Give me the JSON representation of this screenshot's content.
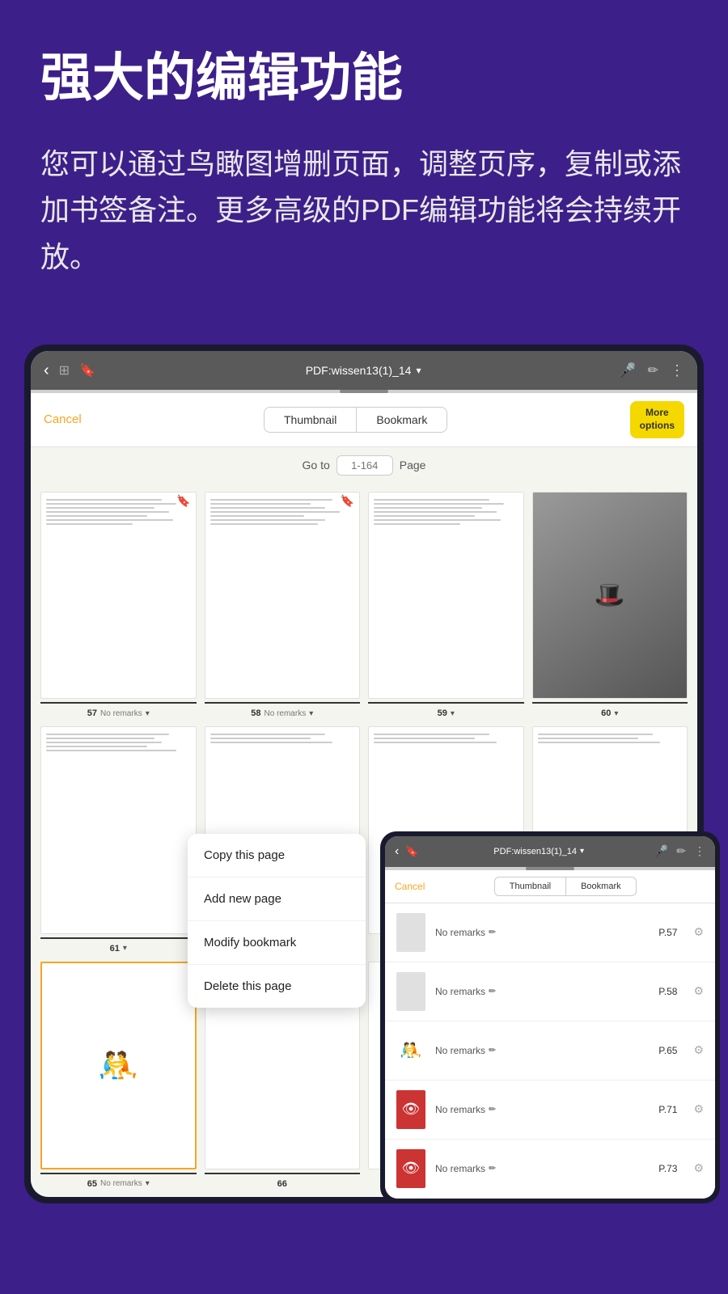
{
  "background_color": "#3d1f8a",
  "header": {
    "title": "强大的编辑功能",
    "description": "您可以通过鸟瞰图增删页面，调整页序，复制或添加书签备注。更多高级的PDF编辑功能将会持续开放。"
  },
  "tablet": {
    "topbar": {
      "title": "PDF:wissen13(1)_14",
      "chevron": "▾",
      "back_icon": "‹",
      "mic_icon": "🎤",
      "pen_icon": "✏",
      "more_icon": "⋮"
    },
    "toolbar": {
      "cancel_label": "Cancel",
      "tab_thumbnail": "Thumbnail",
      "tab_bookmark": "Bookmark",
      "more_options_label": "More\noptions"
    },
    "goto_bar": {
      "label_before": "Go to",
      "placeholder": "1-164",
      "label_after": "Page"
    },
    "thumbnails_row1": [
      {
        "page": "57",
        "remark": "No remarks",
        "has_bookmark": true
      },
      {
        "page": "58",
        "remark": "No remarks",
        "has_bookmark": true
      },
      {
        "page": "59",
        "remark": "",
        "has_bookmark": false
      },
      {
        "page": "60",
        "remark": "",
        "has_bookmark": false,
        "is_art": true
      }
    ],
    "thumbnails_row2": [
      {
        "page": "61",
        "remark": "",
        "has_bookmark": false
      },
      {
        "page": "",
        "remark": "",
        "has_bookmark": false
      },
      {
        "page": "",
        "remark": "",
        "has_bookmark": false
      },
      {
        "page": "",
        "remark": "",
        "has_bookmark": false
      }
    ],
    "thumbnails_row3": [
      {
        "page": "65",
        "remark": "No remarks",
        "has_bookmark": false,
        "is_art": true,
        "selected": true
      },
      {
        "page": "66",
        "remark": "",
        "has_bookmark": false
      },
      {
        "page": "",
        "remark": "",
        "has_bookmark": false
      },
      {
        "page": "",
        "remark": "",
        "has_bookmark": false
      }
    ]
  },
  "context_menu": {
    "items": [
      "Copy this page",
      "Add new page",
      "Modify bookmark",
      "Delete this page"
    ]
  },
  "second_tablet": {
    "topbar": {
      "title": "PDF:wissen13(1)_14",
      "chevron": "▾",
      "mic_icon": "🎤",
      "pen_icon": "✏",
      "more_icon": "⋮"
    },
    "toolbar": {
      "cancel_label": "Cancel",
      "tab_thumbnail": "Thumbnail",
      "tab_bookmark": "Bookmark"
    },
    "bookmark_items": [
      {
        "page": "P.57",
        "remark": "No remarks",
        "pencil": "✏",
        "has_art": false
      },
      {
        "page": "P.58",
        "remark": "No remarks",
        "pencil": "✏",
        "has_art": false
      },
      {
        "page": "P.65",
        "remark": "No remarks",
        "pencil": "✏",
        "has_art": true,
        "art": "🤼"
      },
      {
        "page": "P.71",
        "remark": "No remarks",
        "pencil": "✏",
        "has_art": true,
        "art": "👁"
      },
      {
        "page": "P.73",
        "remark": "No remarks",
        "pencil": "✏",
        "has_art": true,
        "art": "👁"
      }
    ]
  }
}
